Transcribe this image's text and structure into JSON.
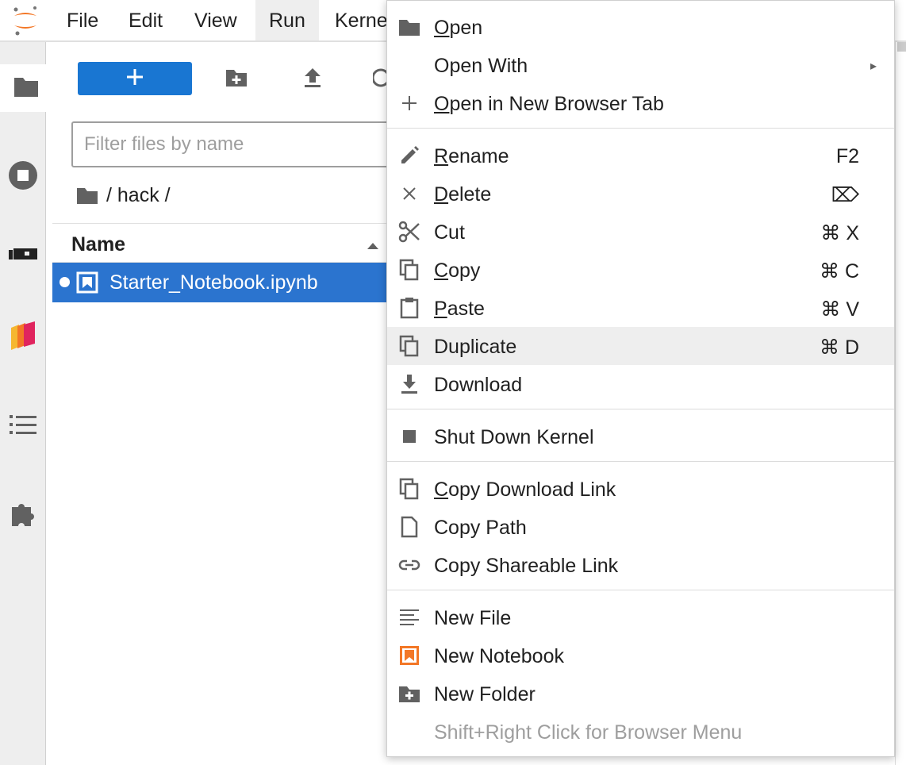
{
  "menubar": {
    "items": [
      "File",
      "Edit",
      "View",
      "Run",
      "Kernel"
    ]
  },
  "activity_bar": {
    "items": [
      "folder-icon",
      "running-icon",
      "gpu-icon",
      "property-inspector-icon",
      "toc-icon",
      "extension-icon"
    ]
  },
  "file_browser": {
    "new_button_label": "+",
    "filter_placeholder": "Filter files by name",
    "breadcrumb": "/ hack /",
    "column_name": "Name",
    "files": [
      {
        "name": "Starter_Notebook.ipynb",
        "selected": true,
        "running": true
      }
    ]
  },
  "context_menu": {
    "items": [
      {
        "label_u": "O",
        "label_rest": "pen",
        "icon": "folder-icon"
      },
      {
        "label_u": "",
        "label_rest": "Open With",
        "icon": "",
        "submenu": "▸"
      },
      {
        "label_u": "O",
        "label_rest": "pen in New Browser Tab",
        "icon": "add-icon"
      },
      {
        "label_u": "R",
        "label_rest": "ename",
        "icon": "edit-icon",
        "shortcut": "F2"
      },
      {
        "label_u": "D",
        "label_rest": "elete",
        "icon": "close-icon",
        "shortcut": "⌦"
      },
      {
        "label_u": "",
        "label_rest": "Cut",
        "icon": "cut-icon",
        "shortcut": "⌘ X"
      },
      {
        "label_u": "C",
        "label_rest": "opy",
        "icon": "copy-icon",
        "shortcut": "⌘ C"
      },
      {
        "label_u": "P",
        "label_rest": "aste",
        "icon": "paste-icon",
        "shortcut": "⌘ V"
      },
      {
        "label_u": "",
        "label_rest": "Duplicate",
        "icon": "duplicate-icon",
        "shortcut": "⌘ D"
      },
      {
        "label_u": "",
        "label_rest": "Download",
        "icon": "download-icon"
      },
      {
        "label_u": "",
        "label_rest": "Shut Down Kernel",
        "icon": "stop-icon"
      },
      {
        "label_u": "C",
        "label_rest": "opy Download Link",
        "icon": "copy-icon"
      },
      {
        "label_u": "",
        "label_rest": "Copy Path",
        "icon": "file-icon"
      },
      {
        "label_u": "",
        "label_rest": "Copy Shareable Link",
        "icon": "link-icon"
      },
      {
        "label_u": "",
        "label_rest": "New File",
        "icon": "text-file-icon"
      },
      {
        "label_u": "",
        "label_rest": "New Notebook",
        "icon": "notebook-icon"
      },
      {
        "label_u": "",
        "label_rest": "New Folder",
        "icon": "new-folder-icon"
      },
      {
        "label_u": "",
        "label_rest": "Shift+Right Click for Browser Menu",
        "icon": "",
        "disabled": true
      }
    ],
    "highlighted_item": "Duplicate"
  },
  "colors": {
    "accent": "#1976d2",
    "selection": "#2b74cf",
    "notebook_orange": "#f37726"
  }
}
